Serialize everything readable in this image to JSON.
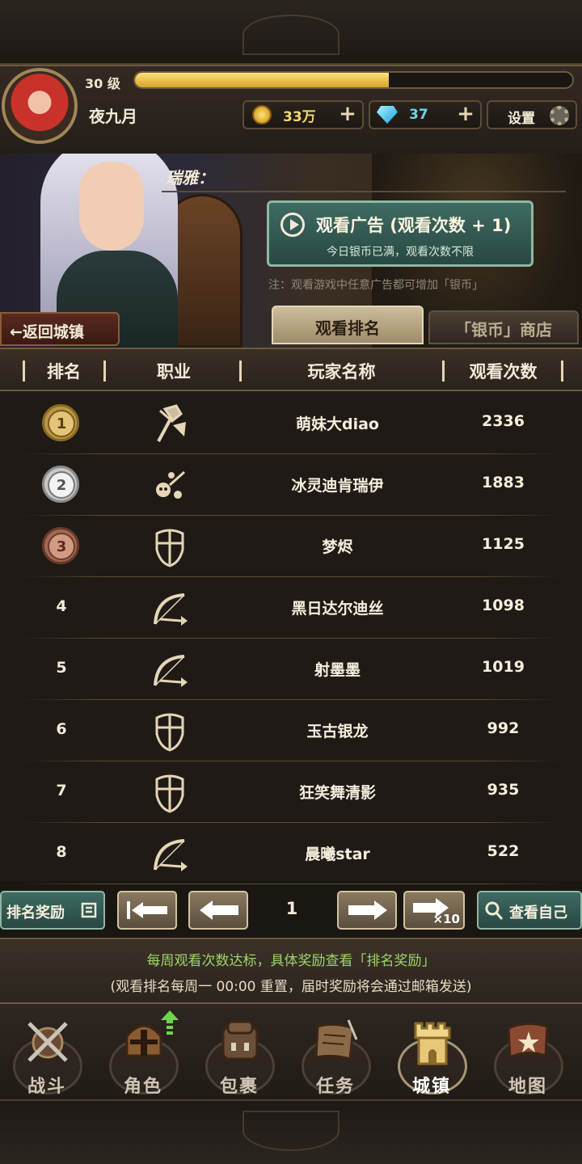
{
  "header": {
    "level": "30 级",
    "xp_fraction": 0.58,
    "player_name": "夜九月",
    "coins": "33万",
    "gems": "37",
    "settings_label": "设置"
  },
  "scene": {
    "speaker": "瑞雅：",
    "ad_button": {
      "title": "观看广告 (观看次数 + 1)",
      "subtitle": "今日银币已满，观看次数不限"
    },
    "note": "注：观看游戏中任意广告都可增加「银币」",
    "back_label": "←返回城镇",
    "tabs": [
      {
        "label": "观看排名",
        "active": true
      },
      {
        "label": "「银币」商店",
        "active": false
      }
    ]
  },
  "table": {
    "headers": [
      "排名",
      "职业",
      "玩家名称",
      "观看次数"
    ],
    "rows": [
      {
        "rank": "1",
        "medal": "gold",
        "class_icon": "axe-icon",
        "name": "萌妹大diao",
        "views": "2336"
      },
      {
        "rank": "2",
        "medal": "silver",
        "class_icon": "skull-staff-icon",
        "name": "冰灵迪肯瑞伊",
        "views": "1883"
      },
      {
        "rank": "3",
        "medal": "bronze",
        "class_icon": "shield-icon",
        "name": "梦烬",
        "views": "1125"
      },
      {
        "rank": "4",
        "medal": "",
        "class_icon": "bow-icon",
        "name": "黑日达尔迪丝",
        "views": "1098"
      },
      {
        "rank": "5",
        "medal": "",
        "class_icon": "bow-icon",
        "name": "射墨墨",
        "views": "1019"
      },
      {
        "rank": "6",
        "medal": "",
        "class_icon": "shield-icon",
        "name": "玉古银龙",
        "views": "992"
      },
      {
        "rank": "7",
        "medal": "",
        "class_icon": "shield-icon",
        "name": "狂笑舞清影",
        "views": "935"
      },
      {
        "rank": "8",
        "medal": "",
        "class_icon": "bow-icon",
        "name": "晨曦star",
        "views": "522"
      }
    ]
  },
  "pager": {
    "reward_label": "排名奖励",
    "page": "1",
    "x10_label": "×10",
    "view_self_label": "查看自己"
  },
  "info": {
    "line1": "每周观看次数达标，具体奖励查看「排名奖励」",
    "line2": "(观看排名每周一 00:00 重置，届时奖励将会通过邮箱发送)"
  },
  "nav": {
    "items": [
      {
        "label": "战斗",
        "icon": "sword-shield-icon"
      },
      {
        "label": "角色",
        "icon": "helmet-icon"
      },
      {
        "label": "包裹",
        "icon": "backpack-icon"
      },
      {
        "label": "任务",
        "icon": "scroll-icon"
      },
      {
        "label": "城镇",
        "icon": "tower-icon",
        "active": true
      },
      {
        "label": "地图",
        "icon": "map-icon"
      }
    ]
  },
  "colors": {
    "gold_bar": "#e8b83a",
    "green_button": "#3f6b62",
    "info_green": "#9fd46a"
  }
}
